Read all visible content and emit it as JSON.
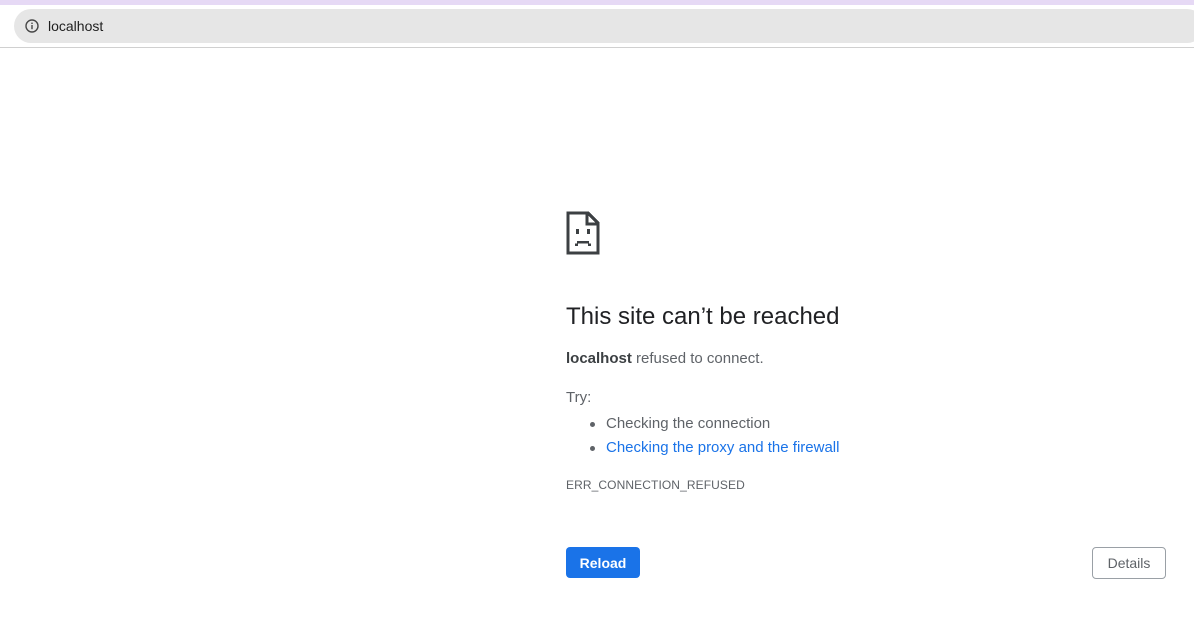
{
  "browser": {
    "address_bar": {
      "url": "localhost",
      "security_icon": "info-icon"
    }
  },
  "error_page": {
    "icon": "sad-page-icon",
    "title": "This site can’t be reached",
    "host": "localhost",
    "message": "refused to connect.",
    "try_label": "Try:",
    "suggestions": [
      {
        "text": "Checking the connection",
        "is_link": false
      },
      {
        "text": "Checking the proxy and the firewall",
        "is_link": true
      }
    ],
    "error_code": "ERR_CONNECTION_REFUSED",
    "reload_label": "Reload",
    "details_label": "Details"
  },
  "colors": {
    "accent": "#1a73e8",
    "title_text": "#202124",
    "body_text": "#5f6368",
    "address_bar_bg": "#e6e6e6",
    "top_strip": "#e6d9f5"
  }
}
